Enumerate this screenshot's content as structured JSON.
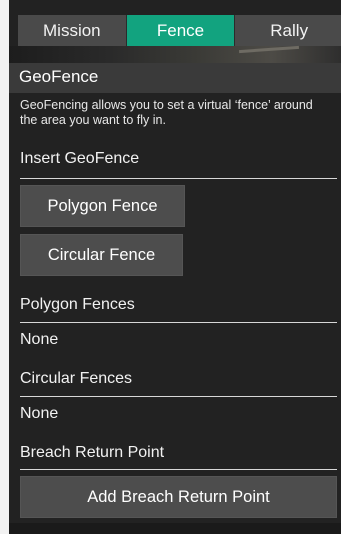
{
  "tabs": [
    {
      "label": "Mission",
      "active": false
    },
    {
      "label": "Fence",
      "active": true
    },
    {
      "label": "Rally",
      "active": false
    }
  ],
  "geofence": {
    "title": "GeoFence",
    "description": "GeoFencing allows you to set a virtual ‘fence’ around the area you want to fly in.",
    "insert_label": "Insert GeoFence",
    "polygon_button": "Polygon Fence",
    "circular_button": "Circular Fence",
    "polygon_fences_label": "Polygon Fences",
    "polygon_fences_value": "None",
    "circular_fences_label": "Circular Fences",
    "circular_fences_value": "None",
    "breach_label": "Breach Return Point",
    "breach_button": "Add Breach Return Point"
  },
  "colors": {
    "active_tab": "#12a37f",
    "tab_bg": "#4a4a4a",
    "panel_bg": "#222222",
    "button_bg": "#4d4d4d"
  }
}
